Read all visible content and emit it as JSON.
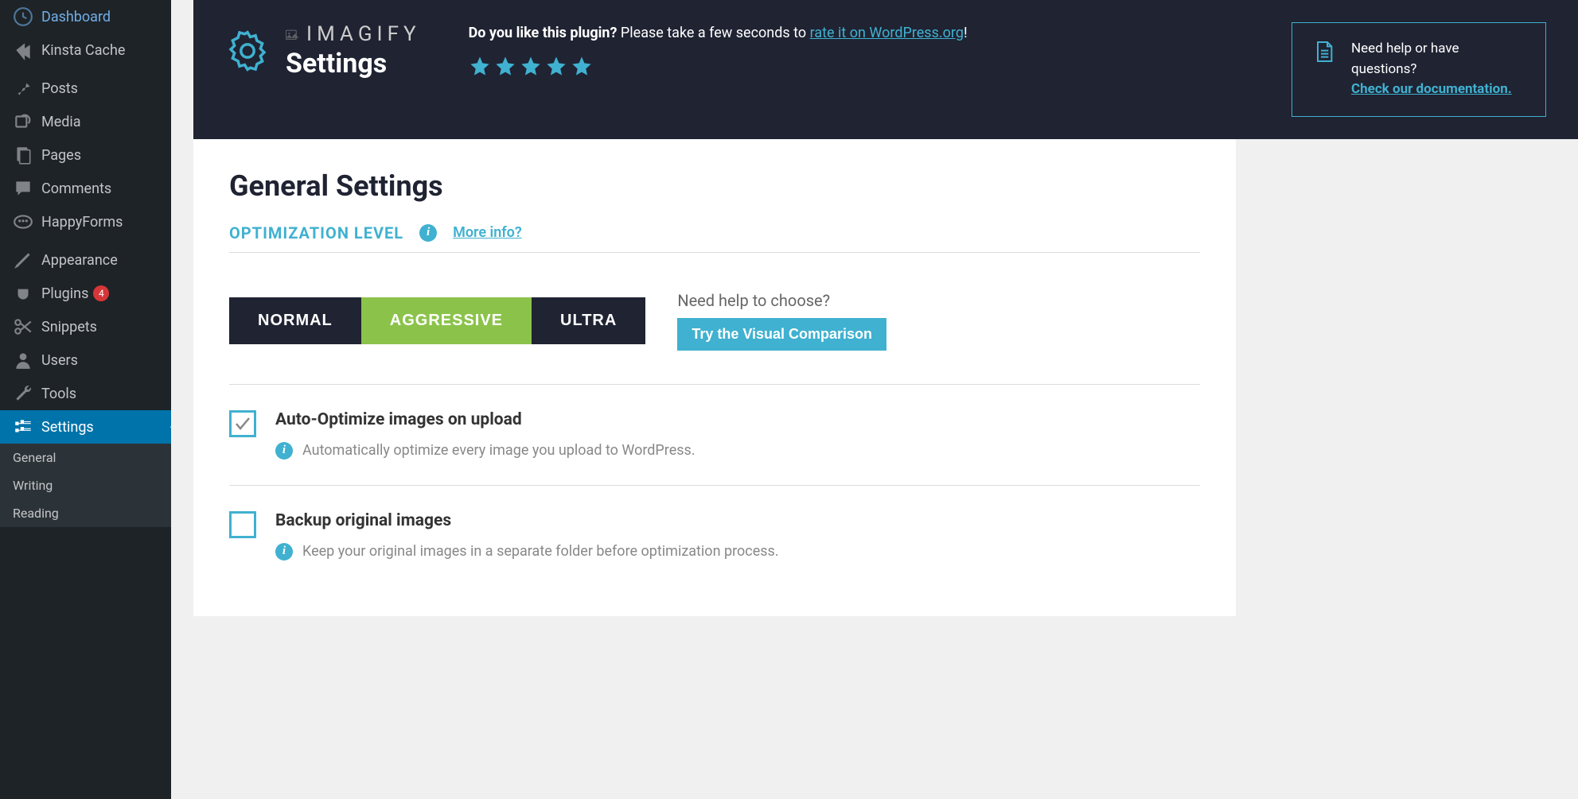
{
  "sidebar": {
    "items": [
      {
        "label": "Dashboard",
        "icon": "dashboard"
      },
      {
        "label": "Kinsta Cache",
        "icon": "kinsta"
      },
      {
        "label": "Posts",
        "icon": "pin"
      },
      {
        "label": "Media",
        "icon": "media"
      },
      {
        "label": "Pages",
        "icon": "pages"
      },
      {
        "label": "Comments",
        "icon": "comments"
      },
      {
        "label": "HappyForms",
        "icon": "forms"
      },
      {
        "label": "Appearance",
        "icon": "appearance"
      },
      {
        "label": "Plugins",
        "icon": "plugins",
        "badge": "4"
      },
      {
        "label": "Snippets",
        "icon": "snippets"
      },
      {
        "label": "Users",
        "icon": "users"
      },
      {
        "label": "Tools",
        "icon": "tools"
      },
      {
        "label": "Settings",
        "icon": "settings",
        "active": true
      }
    ],
    "submenu": [
      "General",
      "Writing",
      "Reading"
    ]
  },
  "banner": {
    "brand": "IMAGIFY",
    "subtitle": "Settings",
    "rate_prefix_bold": "Do you like this plugin?",
    "rate_prefix": " Please take a few seconds to ",
    "rate_link": "rate it on WordPress.org",
    "rate_suffix": "!",
    "help_text": "Need help or have questions?",
    "help_link": "Check our documentation."
  },
  "panel": {
    "title": "General Settings",
    "section_label": "OPTIMIZATION LEVEL",
    "more_info": "More info?",
    "levels": [
      "NORMAL",
      "AGGRESSIVE",
      "ULTRA"
    ],
    "active_level": "AGGRESSIVE",
    "choose_help": "Need help to choose?",
    "visual_btn": "Try the Visual Comparison",
    "options": [
      {
        "title": "Auto-Optimize images on upload",
        "desc": "Automatically optimize every image you upload to WordPress.",
        "checked": true
      },
      {
        "title": "Backup original images",
        "desc": "Keep your original images in a separate folder before optimization process.",
        "checked": false
      }
    ]
  }
}
